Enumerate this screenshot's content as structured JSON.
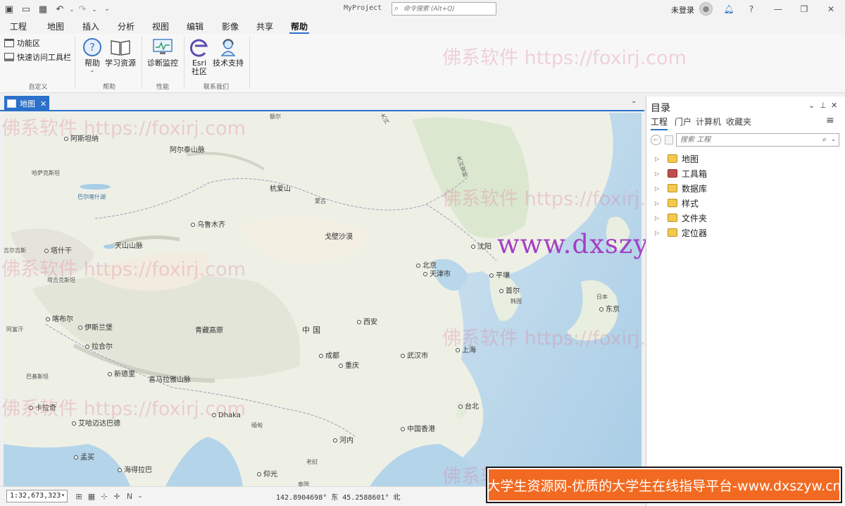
{
  "titlebar": {
    "project_name": "MyProject",
    "search_placeholder": "命令搜索 (Alt+Q)",
    "user_label": "未登录",
    "help": "?"
  },
  "ribbon_tabs": [
    "工程",
    "地图",
    "插入",
    "分析",
    "视图",
    "编辑",
    "影像",
    "共享",
    "帮助"
  ],
  "active_tab": "帮助",
  "ribbon": {
    "customize": {
      "ribbon_label": "功能区",
      "qat_label": "快速访问工具栏",
      "group_label": "自定义"
    },
    "help_group": {
      "help_label": "帮助",
      "learning_label": "学习资源",
      "group_label": "帮助"
    },
    "perf_group": {
      "diag_label": "诊断监控",
      "group_label": "性能"
    },
    "contact_group": {
      "esri_label_1": "Esri",
      "esri_label_2": "社区",
      "support_label": "技术支持",
      "group_label": "联系我们"
    }
  },
  "map_tab": {
    "label": "地图"
  },
  "map_labels": [
    {
      "text": "阿斯坦纳",
      "kind": "city"
    },
    {
      "text": "阿尔泰山脉",
      "kind": "plain"
    },
    {
      "text": "哈萨克斯坦",
      "kind": "plain"
    },
    {
      "text": "巴尔喀什湖",
      "kind": "water"
    },
    {
      "text": "杭爱山",
      "kind": "plain"
    },
    {
      "text": "蒙古",
      "kind": "plain"
    },
    {
      "text": "乌鲁木齐",
      "kind": "city"
    },
    {
      "text": "戈壁沙漠",
      "kind": "plain"
    },
    {
      "text": "天山山脉",
      "kind": "plain"
    },
    {
      "text": "塔什干",
      "kind": "city"
    },
    {
      "text": "塔吉克斯坦",
      "kind": "plain"
    },
    {
      "text": "喀布尔",
      "kind": "city"
    },
    {
      "text": "伊斯兰堡",
      "kind": "city"
    },
    {
      "text": "阿富汗",
      "kind": "plain"
    },
    {
      "text": "拉合尔",
      "kind": "city"
    },
    {
      "text": "青藏高原",
      "kind": "plain"
    },
    {
      "text": "中国",
      "kind": "plain"
    },
    {
      "text": "西安",
      "kind": "city"
    },
    {
      "text": "北京",
      "kind": "city"
    },
    {
      "text": "天津市",
      "kind": "city"
    },
    {
      "text": "沈阳",
      "kind": "city"
    },
    {
      "text": "平壤",
      "kind": "city"
    },
    {
      "text": "首尔",
      "kind": "city"
    },
    {
      "text": "韩国",
      "kind": "plain"
    },
    {
      "text": "日本",
      "kind": "plain"
    },
    {
      "text": "东京",
      "kind": "city"
    },
    {
      "text": "新德里",
      "kind": "city"
    },
    {
      "text": "巴基斯坦",
      "kind": "plain"
    },
    {
      "text": "喜马拉雅山脉",
      "kind": "plain"
    },
    {
      "text": "成都",
      "kind": "city"
    },
    {
      "text": "重庆",
      "kind": "city"
    },
    {
      "text": "武汉市",
      "kind": "city"
    },
    {
      "text": "上海",
      "kind": "city"
    },
    {
      "text": "卡拉奇",
      "kind": "city"
    },
    {
      "text": "艾哈迈达巴德",
      "kind": "city"
    },
    {
      "text": "Dhaka",
      "kind": "city"
    },
    {
      "text": "缅甸",
      "kind": "plain"
    },
    {
      "text": "中国香港",
      "kind": "city"
    },
    {
      "text": "台北",
      "kind": "city"
    },
    {
      "text": "河内",
      "kind": "city"
    },
    {
      "text": "孟买",
      "kind": "city"
    },
    {
      "text": "海得拉巴",
      "kind": "city"
    },
    {
      "text": "老挝",
      "kind": "plain"
    },
    {
      "text": "仰光",
      "kind": "city"
    },
    {
      "text": "泰国",
      "kind": "plain"
    },
    {
      "text": "大兴安岭",
      "kind": "vertical"
    },
    {
      "text": "大兴",
      "kind": "vertical"
    },
    {
      "text": "额尔",
      "kind": "plain"
    },
    {
      "text": "吉尔吉斯",
      "kind": "plain"
    }
  ],
  "watermarks": {
    "foxirj": "佛系软件 https://foxirj.com",
    "dxszyw": "www.dxszyw.cn"
  },
  "status": {
    "scale": "1:32,673,323",
    "coords": "142.8904698° 东 45.2588601° 北"
  },
  "catalog": {
    "title": "目录",
    "tabs": [
      "工程",
      "门户",
      "计算机",
      "收藏夹"
    ],
    "active_tab": "工程",
    "search_placeholder": "搜索 工程",
    "items": [
      "地图",
      "工具箱",
      "数据库",
      "样式",
      "文件夹",
      "定位器"
    ]
  },
  "banner": {
    "text": "大学生资源网-优质的大学生在线指导平台-www.dxszyw.cn"
  },
  "colors": {
    "accent": "#2b70c9",
    "banner_bg": "#f26a21",
    "watermark_purple": "#a340c4",
    "watermark_pink": "#e17896"
  }
}
